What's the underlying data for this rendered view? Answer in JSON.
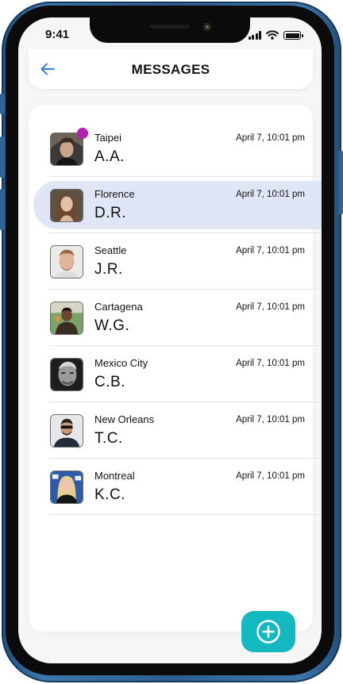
{
  "status_bar": {
    "time": "9:41"
  },
  "header": {
    "title": "MESSAGES"
  },
  "colors": {
    "accent": "#14b8c0",
    "unread": "#b31fb1",
    "selected_row": "#e1e6f7",
    "back_arrow": "#3c7be0"
  },
  "messages": [
    {
      "city": "Taipei",
      "name": "A.A.",
      "time": "April 7, 10:01 pm",
      "unread": true,
      "selected": false
    },
    {
      "city": "Florence",
      "name": "D.R.",
      "time": "April 7, 10:01 pm",
      "unread": false,
      "selected": true
    },
    {
      "city": "Seattle",
      "name": "J.R.",
      "time": "April 7, 10:01 pm",
      "unread": false,
      "selected": false
    },
    {
      "city": "Cartagena",
      "name": "W.G.",
      "time": "April 7, 10:01 pm",
      "unread": false,
      "selected": false
    },
    {
      "city": "Mexico City",
      "name": "C.B.",
      "time": "April 7, 10:01 pm",
      "unread": false,
      "selected": false
    },
    {
      "city": "New Orleans",
      "name": "T.C.",
      "time": "April 7, 10:01 pm",
      "unread": false,
      "selected": false
    },
    {
      "city": "Montreal",
      "name": "K.C.",
      "time": "April 7, 10:01 pm",
      "unread": false,
      "selected": false
    }
  ],
  "icons": {
    "back": "arrow-left-icon",
    "fab": "plus-circle-icon",
    "signal": "cellular-signal-icon",
    "wifi": "wifi-icon",
    "battery": "battery-icon"
  }
}
